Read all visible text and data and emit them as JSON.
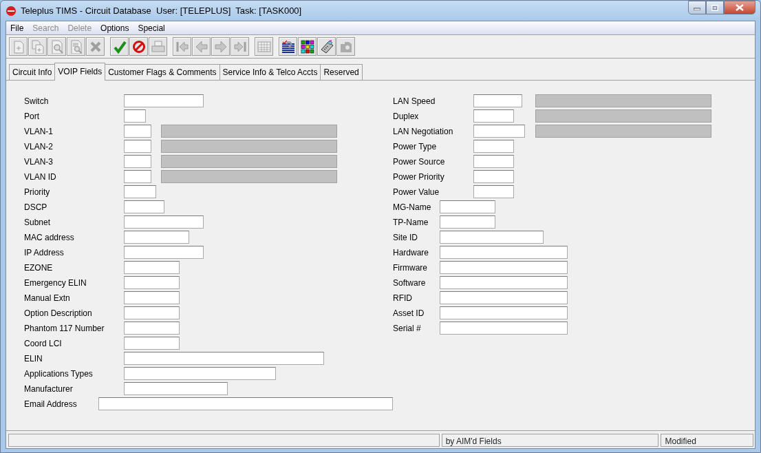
{
  "window": {
    "title": "Teleplus TIMS - Circuit Database  User: [TELEPLUS]  Task: [TASK000]"
  },
  "menu": [
    {
      "label": "File",
      "disabled": false
    },
    {
      "label": "Search",
      "disabled": true
    },
    {
      "label": "Delete",
      "disabled": true
    },
    {
      "label": "Options",
      "disabled": false
    },
    {
      "label": "Special",
      "disabled": false
    }
  ],
  "toolbar": [
    {
      "kind": "new",
      "disabled": true
    },
    {
      "kind": "copy",
      "disabled": true
    },
    {
      "kind": "find",
      "disabled": true
    },
    {
      "kind": "find-document",
      "disabled": true
    },
    {
      "kind": "delete",
      "disabled": true
    },
    {
      "kind": "save",
      "disabled": false
    },
    {
      "kind": "cancel",
      "disabled": false
    },
    {
      "kind": "print",
      "disabled": true
    },
    {
      "kind": "first",
      "disabled": true
    },
    {
      "kind": "previous",
      "disabled": true
    },
    {
      "kind": "next",
      "disabled": true
    },
    {
      "kind": "last",
      "disabled": true
    },
    {
      "kind": "calendar",
      "disabled": true
    },
    {
      "kind": "help-list",
      "disabled": false
    },
    {
      "kind": "grid",
      "disabled": false
    },
    {
      "kind": "device",
      "disabled": false
    },
    {
      "kind": "tool",
      "disabled": true
    }
  ],
  "tabs": [
    {
      "label": "Circuit Info",
      "selected": false
    },
    {
      "label": "VOIP Fields",
      "selected": true
    },
    {
      "label": "Customer Flags & Comments",
      "selected": false
    },
    {
      "label": "Service Info & Telco Accts",
      "selected": false
    },
    {
      "label": "Reserved",
      "selected": false
    }
  ],
  "left_fields": [
    {
      "label": "Switch",
      "kind": "text"
    },
    {
      "label": "Port",
      "kind": "text"
    },
    {
      "label": "VLAN-1",
      "kind": "code"
    },
    {
      "label": "VLAN-2",
      "kind": "code"
    },
    {
      "label": "VLAN-3",
      "kind": "code"
    },
    {
      "label": "VLAN ID",
      "kind": "code"
    },
    {
      "label": "Priority",
      "kind": "text"
    },
    {
      "label": "DSCP",
      "kind": "text"
    },
    {
      "label": "Subnet",
      "kind": "text"
    },
    {
      "label": "MAC address",
      "kind": "text"
    },
    {
      "label": "IP Address",
      "kind": "text"
    },
    {
      "label": "EZONE",
      "kind": "text"
    },
    {
      "label": "Emergency ELIN",
      "kind": "text"
    },
    {
      "label": "Manual Extn",
      "kind": "text"
    },
    {
      "label": "Option Description",
      "kind": "text"
    },
    {
      "label": "Phantom 117 Number",
      "kind": "text"
    },
    {
      "label": "Coord LCI",
      "kind": "text"
    },
    {
      "label": "ELIN",
      "kind": "text"
    },
    {
      "label": "Applications Types",
      "kind": "text"
    },
    {
      "label": "Manufacturer",
      "kind": "text"
    },
    {
      "label": "Email Address",
      "kind": "text"
    }
  ],
  "right_fields": [
    {
      "label": "LAN Speed",
      "kind": "code"
    },
    {
      "label": "Duplex",
      "kind": "code"
    },
    {
      "label": "LAN Negotiation",
      "kind": "code"
    },
    {
      "label": "Power Type",
      "kind": "text"
    },
    {
      "label": "Power Source",
      "kind": "text"
    },
    {
      "label": "Power Priority",
      "kind": "text"
    },
    {
      "label": "Power Value",
      "kind": "text"
    },
    {
      "label": "MG-Name",
      "kind": "text"
    },
    {
      "label": "TP-Name",
      "kind": "text"
    },
    {
      "label": "Site ID",
      "kind": "text"
    },
    {
      "label": "Hardware",
      "kind": "text"
    },
    {
      "label": "Firmware",
      "kind": "text"
    },
    {
      "label": "Software",
      "kind": "text"
    },
    {
      "label": "RFID",
      "kind": "text"
    },
    {
      "label": "Asset ID",
      "kind": "text"
    },
    {
      "label": "Serial #",
      "kind": "text"
    }
  ],
  "status_bar": [
    "by AIM'd Fields",
    "Modified"
  ]
}
